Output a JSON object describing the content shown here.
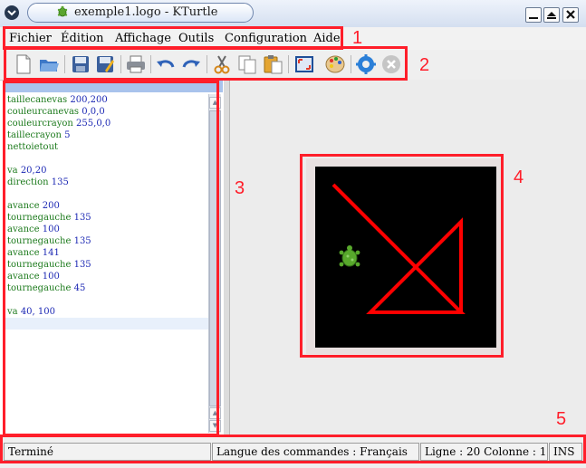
{
  "window": {
    "title": "exemple1.logo - KTurtle"
  },
  "menu": [
    {
      "label": "Fichier"
    },
    {
      "label": "Édition"
    },
    {
      "label": "Affichage"
    },
    {
      "label": "Outils"
    },
    {
      "label": "Configuration"
    },
    {
      "label": "Aide"
    }
  ],
  "toolbar_icons": [
    "new-file-icon",
    "open-folder-icon",
    "save-icon",
    "save-as-icon",
    "print-icon",
    "undo-icon",
    "redo-icon",
    "cut-icon",
    "copy-icon",
    "paste-icon",
    "fullscreen-icon",
    "color-picker-icon",
    "run-icon",
    "stop-icon"
  ],
  "editor": {
    "lines": [
      {
        "cmd": "taillecanevas",
        "arg": "200,200"
      },
      {
        "cmd": "couleurcanevas",
        "arg": "0,0,0"
      },
      {
        "cmd": "couleurcrayon",
        "arg": "255,0,0"
      },
      {
        "cmd": "taillecrayon",
        "arg": "5"
      },
      {
        "cmd": "nettoietout",
        "arg": ""
      },
      {
        "cmd": "",
        "arg": ""
      },
      {
        "cmd": "va",
        "arg": "20,20"
      },
      {
        "cmd": "direction",
        "arg": "135"
      },
      {
        "cmd": "",
        "arg": ""
      },
      {
        "cmd": "avance",
        "arg": "200"
      },
      {
        "cmd": "tournegauche",
        "arg": "135"
      },
      {
        "cmd": "avance",
        "arg": "100"
      },
      {
        "cmd": "tournegauche",
        "arg": "135"
      },
      {
        "cmd": "avance",
        "arg": "141"
      },
      {
        "cmd": "tournegauche",
        "arg": "135"
      },
      {
        "cmd": "avance",
        "arg": "100"
      },
      {
        "cmd": "tournegauche",
        "arg": "45"
      },
      {
        "cmd": "",
        "arg": ""
      },
      {
        "cmd": "va",
        "arg": "40, 100"
      }
    ]
  },
  "canvas": {
    "background": "#000000",
    "pen_color": "#ff0000"
  },
  "statusbar": {
    "state": "Terminé",
    "language": "Langue des commandes : Français",
    "position": "Ligne : 20 Colonne : 1",
    "mode": "INS"
  },
  "annotations": [
    "1",
    "2",
    "3",
    "4",
    "5"
  ],
  "colors": {
    "annotation": "#ff1e2a",
    "highlight": "#a9c3ec"
  }
}
